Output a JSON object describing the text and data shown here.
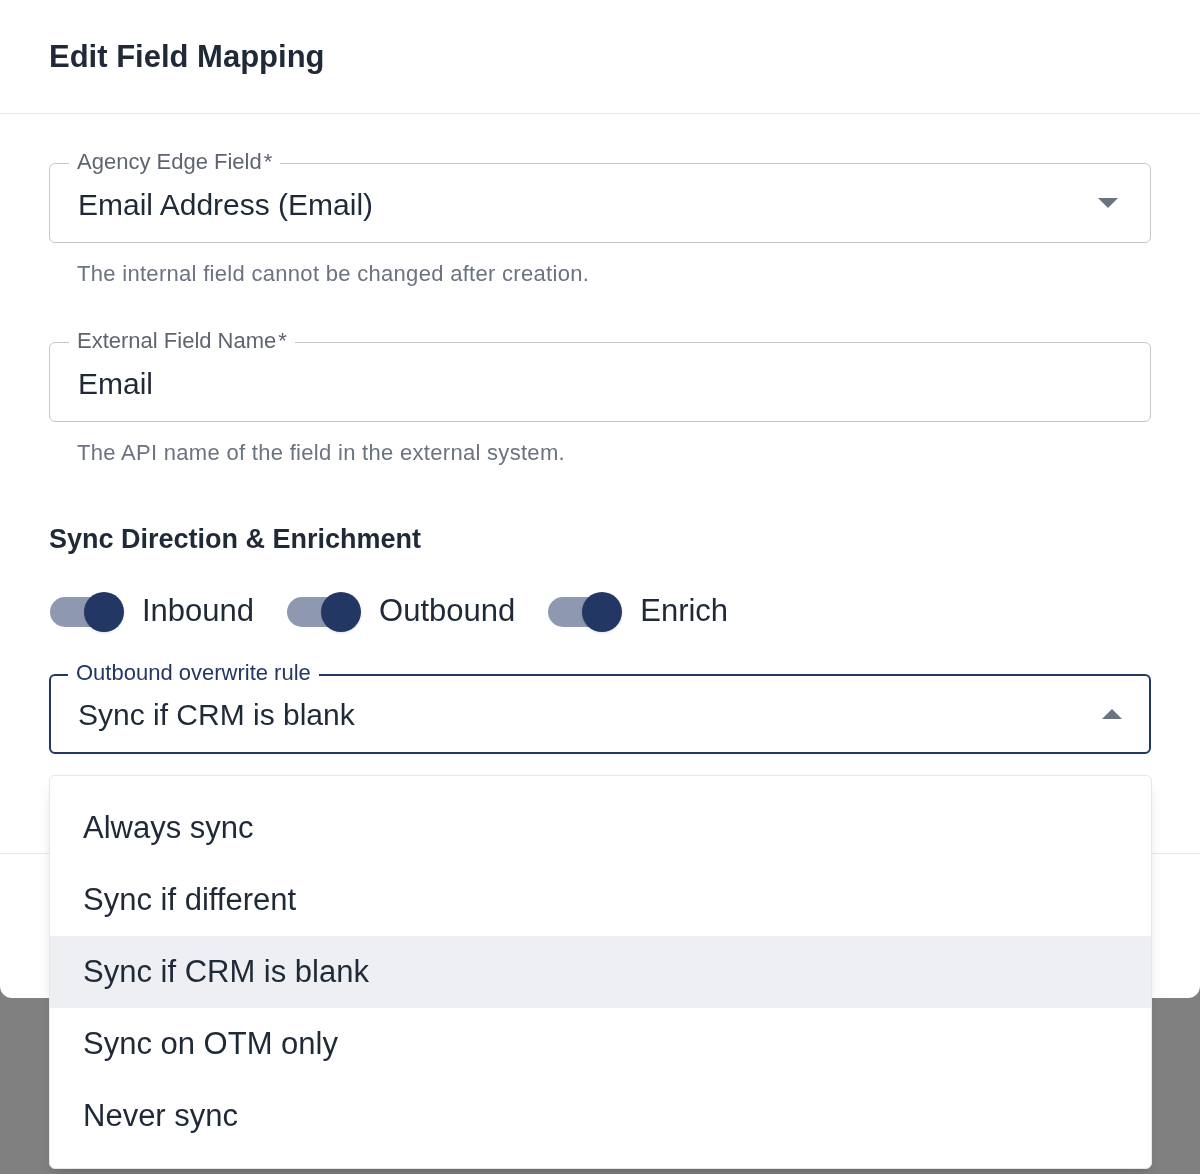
{
  "dialog": {
    "title": "Edit Field Mapping"
  },
  "fields": [
    {
      "kind": "select",
      "label": "Agency Edge Field",
      "marker": "*",
      "value": "Email Address (Email)",
      "helper": "The internal field cannot be changed after creation."
    },
    {
      "kind": "text",
      "label": "External Field Name",
      "marker": "*",
      "value": "Email",
      "helper": "The API name of the field in the external system."
    }
  ],
  "section_title": "Sync Direction & Enrichment",
  "toggles": [
    {
      "label": "Inbound",
      "on": true
    },
    {
      "label": "Outbound",
      "on": true
    },
    {
      "label": "Enrich",
      "on": true
    }
  ],
  "overwrite_rule": {
    "label": "Outbound overwrite rule",
    "value": "Sync if CRM is blank",
    "expanded": true,
    "options": [
      {
        "label": "Always sync",
        "selected": false
      },
      {
        "label": "Sync if different",
        "selected": false
      },
      {
        "label": "Sync if CRM is blank",
        "selected": true
      },
      {
        "label": "Sync on OTM only",
        "selected": false
      },
      {
        "label": "Never sync",
        "selected": false
      }
    ]
  }
}
